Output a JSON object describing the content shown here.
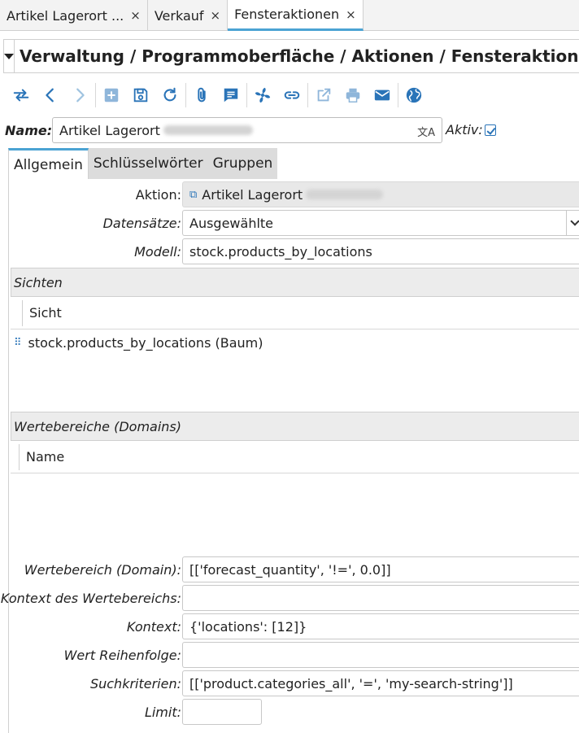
{
  "window_tabs": [
    {
      "label": "Artikel Lagerort ...",
      "close": "×"
    },
    {
      "label": "Verkauf",
      "close": "×"
    },
    {
      "label": "Fensteraktionen",
      "close": "×"
    }
  ],
  "title": "Verwaltung / Programmoberfläche / Aktionen / Fensteraktionen",
  "toolbar_icons": [
    "switch-view-icon",
    "previous-icon",
    "next-icon",
    "new-record-icon",
    "save-icon",
    "reload-icon",
    "attachment-icon",
    "notes-icon",
    "actions-icon",
    "relate-icon",
    "open-icon",
    "print-icon",
    "email-icon",
    "web-icon"
  ],
  "name_row": {
    "label": "Name:",
    "value": "Artikel Lagerort",
    "translate_glyph": "文A",
    "aktiv_label": "Aktiv:",
    "aktiv_checked": true
  },
  "form_tabs": [
    "Allgemein",
    "Schlüsselwörter",
    "Gruppen"
  ],
  "fields": {
    "aktion": {
      "label": "Aktion:",
      "value": "Artikel Lagerort",
      "ext_glyph": "⧉"
    },
    "datensaetze": {
      "label": "Datensätze:",
      "value": "Ausgewählte"
    },
    "modell": {
      "label": "Modell:",
      "value": "stock.products_by_locations"
    }
  },
  "sichten": {
    "heading": "Sichten",
    "column": "Sicht",
    "rows": [
      "stock.products_by_locations (Baum)"
    ],
    "drag_glyph": "⠿"
  },
  "domains": {
    "heading": "Wertebereiche (Domains)",
    "column": "Name"
  },
  "bottom_fields": {
    "domain": {
      "label": "Wertebereich (Domain):",
      "value": "[['forecast_quantity', '!=', 0.0]]"
    },
    "kontext_wb": {
      "label": "Kontext des Wertebereichs:",
      "value": ""
    },
    "kontext": {
      "label": "Kontext:",
      "value": "{'locations': [12]}"
    },
    "reihenfolge": {
      "label": "Wert Reihenfolge:",
      "value": ""
    },
    "suchkriterien": {
      "label": "Suchkriterien:",
      "value": "[['product.categories_all', '=', 'my-search-string']]"
    },
    "limit": {
      "label": "Limit:",
      "value": ""
    }
  },
  "colors": {
    "accent": "#4ba3d3",
    "icon_blue": "#2a74b8"
  }
}
